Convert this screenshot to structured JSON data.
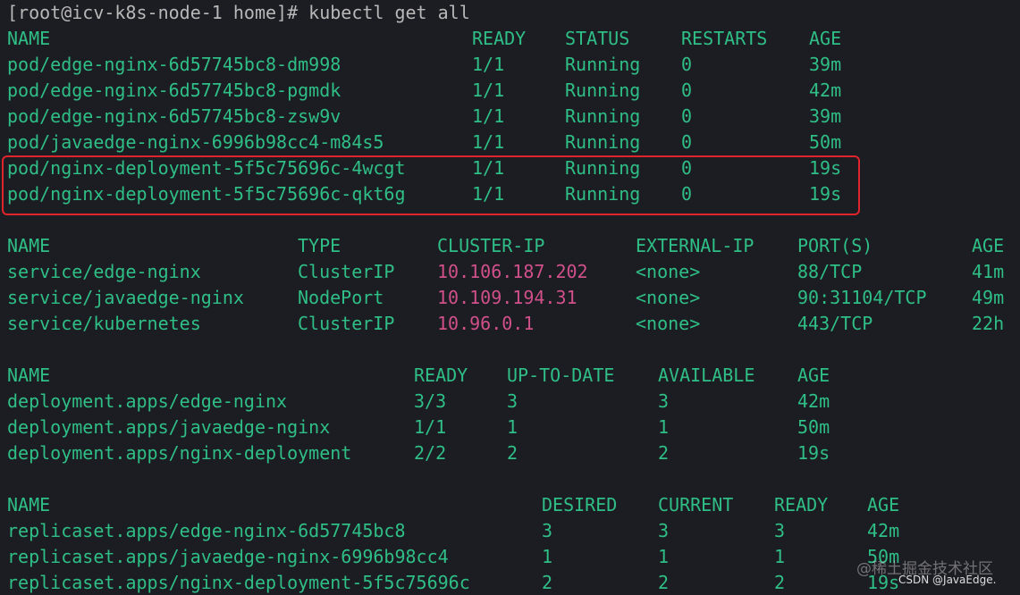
{
  "terminal": {
    "prompt": "[root@icv-k8s-node-1 home]# kubectl get all"
  },
  "pods": {
    "headers": [
      "NAME",
      "READY",
      "STATUS",
      "RESTARTS",
      "AGE"
    ],
    "rows": [
      [
        "pod/edge-nginx-6d57745bc8-dm998",
        "1/1",
        "Running",
        "0",
        "39m"
      ],
      [
        "pod/edge-nginx-6d57745bc8-pgmdk",
        "1/1",
        "Running",
        "0",
        "42m"
      ],
      [
        "pod/edge-nginx-6d57745bc8-zsw9v",
        "1/1",
        "Running",
        "0",
        "39m"
      ],
      [
        "pod/javaedge-nginx-6996b98cc4-m84s5",
        "1/1",
        "Running",
        "0",
        "50m"
      ],
      [
        "pod/nginx-deployment-5f5c75696c-4wcgt",
        "1/1",
        "Running",
        "0",
        "19s"
      ],
      [
        "pod/nginx-deployment-5f5c75696c-qkt6g",
        "1/1",
        "Running",
        "0",
        "19s"
      ]
    ]
  },
  "services": {
    "headers": [
      "NAME",
      "TYPE",
      "CLUSTER-IP",
      "EXTERNAL-IP",
      "PORT(S)",
      "AGE"
    ],
    "rows": [
      [
        "service/edge-nginx",
        "ClusterIP",
        "10.106.187.202",
        "<none>",
        "88/TCP",
        "41m"
      ],
      [
        "service/javaedge-nginx",
        "NodePort",
        "10.109.194.31",
        "<none>",
        "90:31104/TCP",
        "49m"
      ],
      [
        "service/kubernetes",
        "ClusterIP",
        "10.96.0.1",
        "<none>",
        "443/TCP",
        "22h"
      ]
    ]
  },
  "deployments": {
    "headers": [
      "NAME",
      "READY",
      "UP-TO-DATE",
      "AVAILABLE",
      "AGE"
    ],
    "rows": [
      [
        "deployment.apps/edge-nginx",
        "3/3",
        "3",
        "3",
        "42m"
      ],
      [
        "deployment.apps/javaedge-nginx",
        "1/1",
        "1",
        "1",
        "50m"
      ],
      [
        "deployment.apps/nginx-deployment",
        "2/2",
        "2",
        "2",
        "19s"
      ]
    ]
  },
  "replicasets": {
    "headers": [
      "NAME",
      "DESIRED",
      "CURRENT",
      "READY",
      "AGE"
    ],
    "rows": [
      [
        "replicaset.apps/edge-nginx-6d57745bc8",
        "3",
        "3",
        "3",
        "42m"
      ],
      [
        "replicaset.apps/javaedge-nginx-6996b98cc4",
        "1",
        "1",
        "1",
        "50m"
      ],
      [
        "replicaset.apps/nginx-deployment-5f5c75696c",
        "2",
        "2",
        "2",
        "19s"
      ]
    ]
  },
  "colors": {
    "background": "#1c1c23",
    "text": "#2fbf86",
    "prompt": "#b8b8b8",
    "cluster_ip": "#d0508a",
    "highlight_border": "#e0242b"
  },
  "watermark": {
    "site": "@稀土掘金技术社区",
    "credit": "CSDN @JavaEdge."
  }
}
